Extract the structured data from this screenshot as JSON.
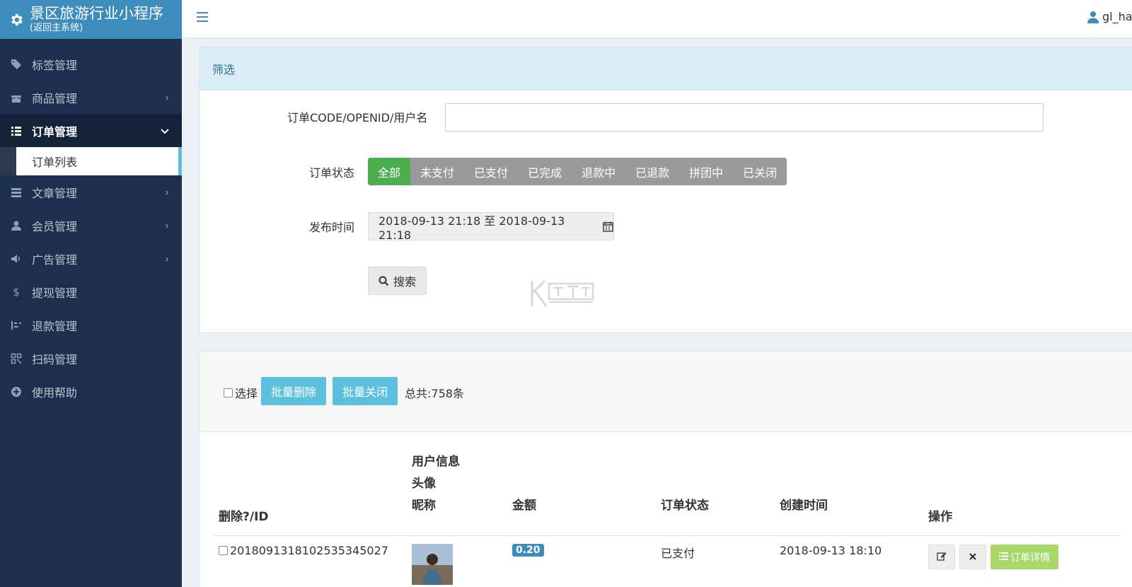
{
  "brand": {
    "title": "景区旅游行业小程序",
    "subtitle": "(返回主系统)"
  },
  "sidebar": {
    "items": [
      {
        "label": "标签管理",
        "icon": "tag-icon",
        "chevron": false
      },
      {
        "label": "商品管理",
        "icon": "gift-icon",
        "chevron": true
      },
      {
        "label": "订单管理",
        "icon": "list-icon",
        "chevron": true,
        "active": true
      },
      {
        "label": "文章管理",
        "icon": "server-icon",
        "chevron": true
      },
      {
        "label": "会员管理",
        "icon": "user-icon",
        "chevron": true
      },
      {
        "label": "广告管理",
        "icon": "volume-icon",
        "chevron": true
      },
      {
        "label": "提现管理",
        "icon": "dollar-icon",
        "chevron": false
      },
      {
        "label": "退款管理",
        "icon": "tasks-icon",
        "chevron": false
      },
      {
        "label": "扫码管理",
        "icon": "qrcode-icon",
        "chevron": false
      },
      {
        "label": "使用帮助",
        "icon": "plus-circle-icon",
        "chevron": false
      }
    ],
    "sub_active": "订单列表"
  },
  "header": {
    "username": "gl_hav"
  },
  "filter": {
    "panel_title": "筛选",
    "code_label": "订单CODE/OPENID/用户名",
    "code_value": "",
    "status_label": "订单状态",
    "status_options": [
      "全部",
      "未支付",
      "已支付",
      "已完成",
      "退款中",
      "已退款",
      "拼团中",
      "已关闭"
    ],
    "status_selected": "全部",
    "time_label": "发布时间",
    "time_range": "2018-09-13 21:18 至 2018-09-13 21:18",
    "search_label": "搜索"
  },
  "watermark": "K",
  "list": {
    "select_label": "选择",
    "batch_delete": "批量删除",
    "batch_close": "批量关闭",
    "total": "总共:758条",
    "columns": {
      "id": "删除?/ID",
      "user_info": "用户信息",
      "avatar": "头像",
      "nickname": "昵称",
      "amount": "金额",
      "status": "订单状态",
      "created": "创建时间",
      "actions": "操作"
    },
    "rows": [
      {
        "id": "2018091318102535345027",
        "amount": "0.20",
        "status": "已支付",
        "created": "2018-09-13 18:10",
        "detail_label": "订单详情"
      }
    ]
  }
}
